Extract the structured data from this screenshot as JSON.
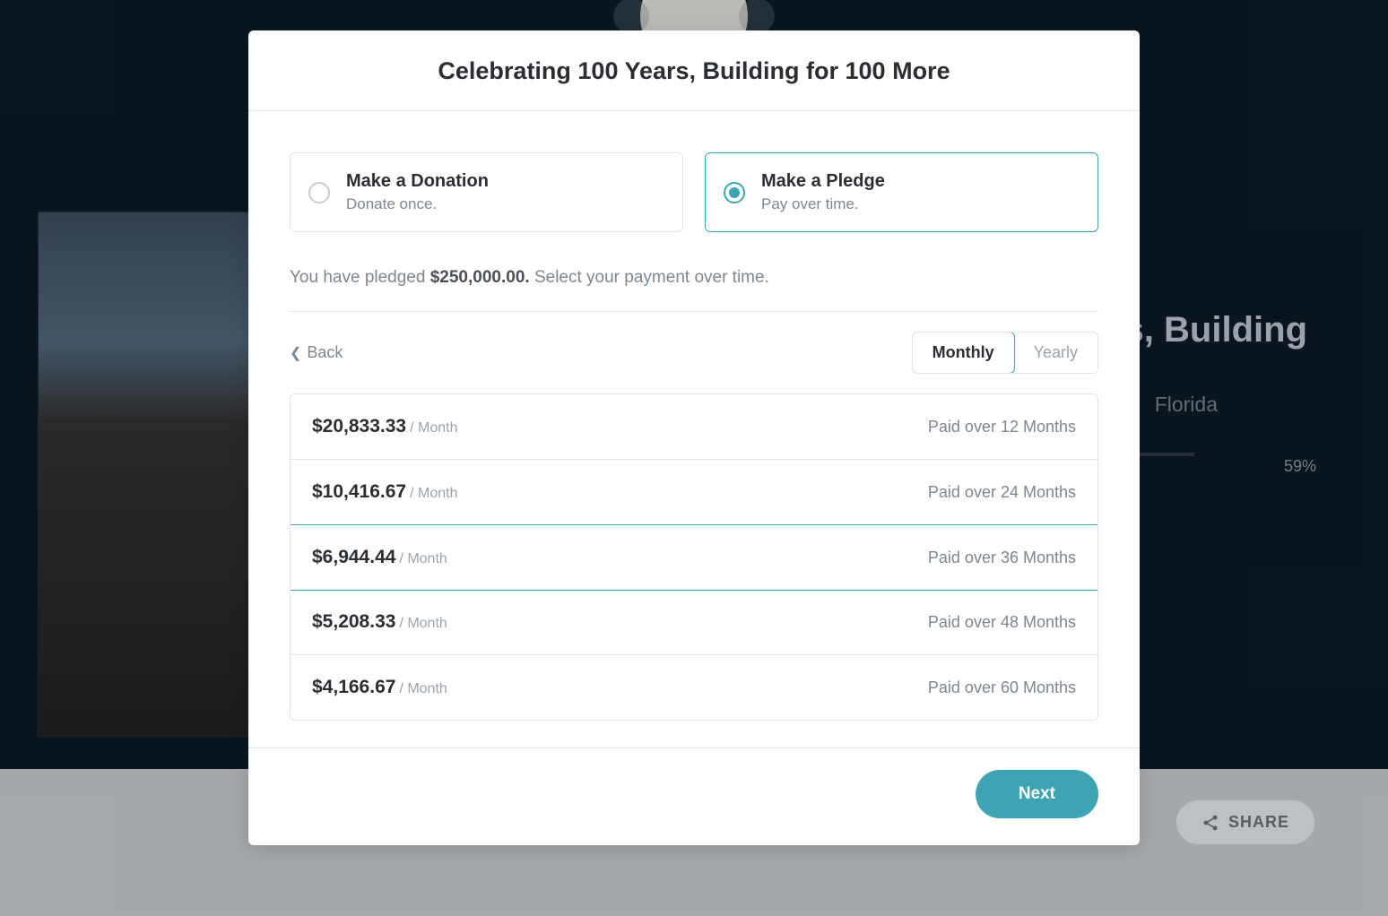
{
  "background": {
    "title_fragment": "s, Building",
    "subtitle_fragment": "Florida",
    "percent": "59%",
    "share_label": "SHARE"
  },
  "modal": {
    "title": "Celebrating 100 Years, Building for 100 More",
    "type_options": {
      "donation": {
        "title": "Make a Donation",
        "subtitle": "Donate once."
      },
      "pledge": {
        "title": "Make a Pledge",
        "subtitle": "Pay over time."
      }
    },
    "pledge_line": {
      "prefix": "You have pledged ",
      "amount": "$250,000.00.",
      "suffix": " Select your payment over time."
    },
    "back_label": "Back",
    "freq_tabs": {
      "monthly": "Monthly",
      "yearly": "Yearly"
    },
    "plans": [
      {
        "amount": "$20,833.33",
        "per": "/ Month",
        "term": "Paid over 12 Months"
      },
      {
        "amount": "$10,416.67",
        "per": "/ Month",
        "term": "Paid over 24 Months"
      },
      {
        "amount": "$6,944.44",
        "per": "/ Month",
        "term": "Paid over 36 Months"
      },
      {
        "amount": "$5,208.33",
        "per": "/ Month",
        "term": "Paid over 48 Months"
      },
      {
        "amount": "$4,166.67",
        "per": "/ Month",
        "term": "Paid over 60 Months"
      }
    ],
    "selected_plan_index": 2,
    "next_label": "Next"
  }
}
